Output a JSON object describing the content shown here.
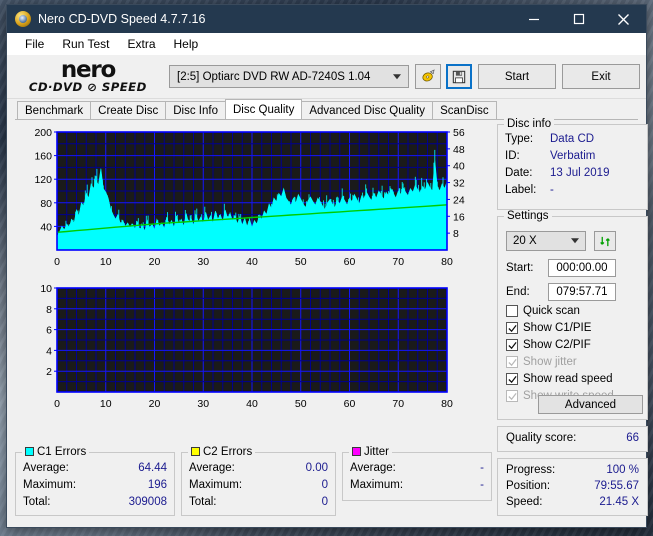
{
  "window": {
    "title": "Nero CD-DVD Speed 4.7.7.16",
    "icon": "nero-disc-icon",
    "minimize_label": "minimize-icon",
    "maximize_label": "maximize-icon",
    "close_label": "close-icon"
  },
  "menu": {
    "items": [
      "File",
      "Run Test",
      "Extra",
      "Help"
    ]
  },
  "toolbar": {
    "logo_line1": "nero",
    "logo_line2": "CD·DVD ⊘ SPEED",
    "drive": "[2:5]   Optiarc DVD RW AD-7240S 1.04",
    "scan_icon": "disc-scan-icon",
    "save_icon": "floppy-save-icon",
    "start_label": "Start",
    "exit_label": "Exit"
  },
  "tabs": [
    {
      "label": "Benchmark",
      "active": false
    },
    {
      "label": "Create Disc",
      "active": false
    },
    {
      "label": "Disc Info",
      "active": false
    },
    {
      "label": "Disc Quality",
      "active": true
    },
    {
      "label": "Advanced Disc Quality",
      "active": false
    },
    {
      "label": "ScanDisc",
      "active": false
    }
  ],
  "disc_info": {
    "legend": "Disc info",
    "rows": [
      {
        "key": "Type:",
        "value": "Data CD"
      },
      {
        "key": "ID:",
        "value": "Verbatim"
      },
      {
        "key": "Date:",
        "value": "13 Jul 2019"
      },
      {
        "key": "Label:",
        "value": "-"
      }
    ]
  },
  "settings": {
    "legend": "Settings",
    "speed": "20 X",
    "refresh_icon": "refresh-arrows-icon",
    "start_label": "Start:",
    "start_value": "000:00.00",
    "end_label": "End:",
    "end_value": "079:57.71",
    "checkboxes": [
      {
        "label": "Quick scan",
        "checked": false,
        "disabled": false
      },
      {
        "label": "Show C1/PIE",
        "checked": true,
        "disabled": false
      },
      {
        "label": "Show C2/PIF",
        "checked": true,
        "disabled": false
      },
      {
        "label": "Show jitter",
        "checked": true,
        "disabled": true
      },
      {
        "label": "Show read speed",
        "checked": true,
        "disabled": false
      },
      {
        "label": "Show write speed",
        "checked": true,
        "disabled": true
      }
    ],
    "advanced_label": "Advanced"
  },
  "quality": {
    "label": "Quality score:",
    "value": "66"
  },
  "progress": {
    "rows": [
      {
        "key": "Progress:",
        "value": "100 %"
      },
      {
        "key": "Position:",
        "value": "79:55.67"
      },
      {
        "key": "Speed:",
        "value": "21.45 X"
      }
    ]
  },
  "stats": {
    "c1": {
      "legend": "C1 Errors",
      "color": "#00ffff",
      "rows": [
        {
          "key": "Average:",
          "value": "64.44"
        },
        {
          "key": "Maximum:",
          "value": "196"
        },
        {
          "key": "Total:",
          "value": "309008"
        }
      ]
    },
    "c2": {
      "legend": "C2 Errors",
      "color": "#ffff00",
      "rows": [
        {
          "key": "Average:",
          "value": "0.00"
        },
        {
          "key": "Maximum:",
          "value": "0"
        },
        {
          "key": "Total:",
          "value": "0"
        }
      ]
    },
    "jitter": {
      "legend": "Jitter",
      "color": "#ff00ff",
      "rows": [
        {
          "key": "Average:",
          "value": "-"
        },
        {
          "key": "Maximum:",
          "value": "-"
        }
      ]
    }
  },
  "chart_data": [
    {
      "type": "area",
      "name": "c1-errors-chart",
      "title": "",
      "xlabel": "",
      "ylabel": "",
      "x_ticks": [
        0,
        10,
        20,
        30,
        40,
        50,
        60,
        70,
        80
      ],
      "xlim": [
        0,
        80
      ],
      "y_left_ticks": [
        40,
        80,
        120,
        160,
        200
      ],
      "ylim": [
        0,
        200
      ],
      "y_right_ticks": [
        8,
        16,
        24,
        32,
        40,
        48,
        56
      ],
      "y_right_lim": [
        0,
        56
      ],
      "grid": true,
      "background": "#1a1a1a",
      "grid_color": "#0000cc",
      "axis_color": "#0000ff",
      "series": [
        {
          "name": "C1 Errors",
          "color": "#00ffff",
          "axis": "left",
          "x": [
            0,
            0.5,
            1,
            1.5,
            2,
            2.5,
            3,
            3.5,
            4,
            4.5,
            5,
            5.5,
            6,
            6.5,
            7,
            7.5,
            8,
            8.5,
            9,
            9.5,
            10,
            10.5,
            11,
            11.5,
            12,
            12.5,
            13,
            13.5,
            14,
            14.5,
            15,
            15.5,
            16,
            16.5,
            17,
            17.5,
            18,
            18.5,
            19,
            19.5,
            20,
            20.5,
            21,
            21.5,
            22,
            22.5,
            23,
            23.5,
            24,
            24.5,
            25,
            25.5,
            26,
            26.5,
            27,
            27.5,
            28,
            28.5,
            29,
            29.5,
            30,
            30.5,
            31,
            31.5,
            32,
            32.5,
            33,
            33.5,
            34,
            34.5,
            35,
            35.5,
            36,
            36.5,
            37,
            37.5,
            38,
            38.5,
            39,
            39.5,
            40,
            40.5,
            41,
            41.5,
            42,
            42.5,
            43,
            43.5,
            44,
            44.5,
            45,
            45.5,
            46,
            46.5,
            47,
            47.5,
            48,
            48.5,
            49,
            49.5,
            50,
            50.5,
            51,
            51.5,
            52,
            52.5,
            53,
            53.5,
            54,
            54.5,
            55,
            55.5,
            56,
            56.5,
            57,
            57.5,
            58,
            58.5,
            59,
            59.5,
            60,
            60.5,
            61,
            61.5,
            62,
            62.5,
            63,
            63.5,
            64,
            64.5,
            65,
            65.5,
            66,
            66.5,
            67,
            67.5,
            68,
            68.5,
            69,
            69.5,
            70,
            70.5,
            71,
            71.5,
            72,
            72.5,
            73,
            73.5,
            74,
            74.5,
            75,
            75.5,
            76,
            76.5,
            77,
            77.5,
            78,
            78.5,
            79,
            79.5,
            80
          ],
          "values": [
            22,
            30,
            40,
            34,
            44,
            38,
            52,
            46,
            68,
            58,
            80,
            74,
            96,
            88,
            112,
            104,
            118,
            110,
            138,
            104,
            98,
            88,
            70,
            60,
            52,
            60,
            44,
            50,
            40,
            46,
            38,
            44,
            36,
            48,
            34,
            42,
            32,
            50,
            38,
            44,
            34,
            52,
            40,
            46,
            36,
            56,
            42,
            50,
            38,
            58,
            44,
            52,
            40,
            62,
            46,
            54,
            42,
            60,
            48,
            56,
            44,
            64,
            50,
            58,
            46,
            66,
            52,
            60,
            48,
            68,
            54,
            62,
            50,
            58,
            44,
            56,
            42,
            54,
            40,
            52,
            38,
            50,
            44,
            58,
            52,
            66,
            60,
            78,
            70,
            88,
            82,
            96,
            90,
            104,
            88,
            82,
            76,
            88,
            80,
            94,
            86,
            78,
            72,
            84,
            90,
            82,
            76,
            88,
            82,
            74,
            68,
            80,
            86,
            78,
            72,
            84,
            78,
            90,
            84,
            76,
            88,
            82,
            94,
            86,
            78,
            92,
            86,
            98,
            90,
            84,
            96,
            88,
            100,
            94,
            86,
            98,
            92,
            104,
            96,
            88,
            100,
            94,
            106,
            98,
            92,
            104,
            98,
            110,
            102,
            96,
            108,
            102,
            114,
            106,
            100,
            152,
            108,
            100,
            112,
            104,
            116,
            108,
            120,
            112,
            124
          ]
        },
        {
          "name": "Read speed",
          "color": "#00cc00",
          "axis": "right",
          "x": [
            0,
            2,
            4,
            6,
            8,
            10,
            12,
            14,
            16,
            18,
            20,
            22,
            24,
            26,
            28,
            30,
            32,
            34,
            36,
            38,
            40,
            42,
            44,
            46,
            48,
            50,
            52,
            54,
            56,
            58,
            60,
            62,
            64,
            66,
            68,
            70,
            72,
            74,
            76,
            78,
            80
          ],
          "values": [
            8.4,
            8.8,
            9.2,
            9.6,
            10.0,
            10.4,
            10.8,
            11.2,
            11.6,
            12.0,
            12.4,
            12.7,
            13.0,
            13.3,
            13.6,
            13.9,
            14.2,
            14.5,
            14.8,
            15.1,
            15.4,
            15.7,
            16.0,
            16.3,
            16.6,
            16.9,
            17.2,
            17.5,
            17.8,
            18.1,
            18.4,
            18.7,
            19.0,
            19.3,
            19.6,
            19.9,
            20.2,
            20.5,
            20.8,
            21.1,
            21.45
          ]
        }
      ]
    },
    {
      "type": "area",
      "name": "c2-errors-chart",
      "title": "",
      "xlabel": "",
      "ylabel": "",
      "x_ticks": [
        0,
        10,
        20,
        30,
        40,
        50,
        60,
        70,
        80
      ],
      "xlim": [
        0,
        80
      ],
      "y_left_ticks": [
        2,
        4,
        6,
        8,
        10
      ],
      "ylim": [
        0,
        10
      ],
      "grid": true,
      "background": "#1a1a1a",
      "grid_color": "#0000cc",
      "axis_color": "#0000ff",
      "series": [
        {
          "name": "C2 Errors",
          "color": "#ffff00",
          "axis": "left",
          "x": [
            0,
            80
          ],
          "values": [
            0,
            0
          ]
        }
      ]
    }
  ]
}
